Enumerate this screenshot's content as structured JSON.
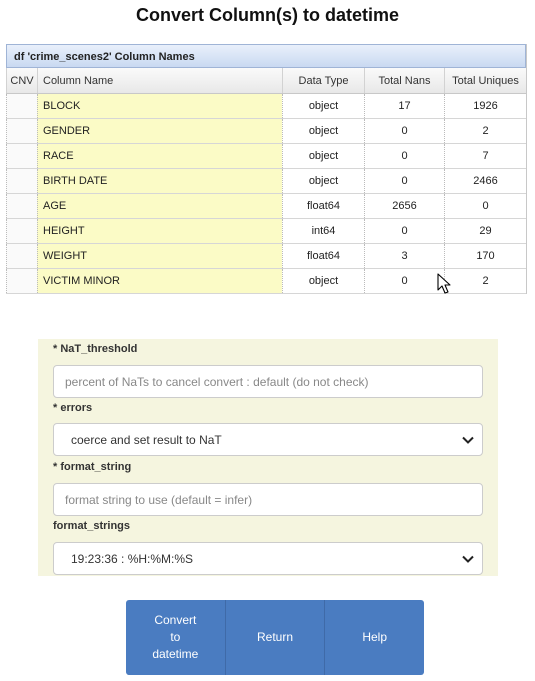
{
  "page": {
    "title": "Convert Column(s) to datetime"
  },
  "grid": {
    "caption": "df 'crime_scenes2' Column Names",
    "headers": {
      "cnv": "CNV",
      "name": "Column Name",
      "type": "Data Type",
      "nans": "Total Nans",
      "uniques": "Total Uniques"
    },
    "rows": [
      {
        "name": "BLOCK",
        "type": "object",
        "nans": "17",
        "uniques": "1926"
      },
      {
        "name": "GENDER",
        "type": "object",
        "nans": "0",
        "uniques": "2"
      },
      {
        "name": "RACE",
        "type": "object",
        "nans": "0",
        "uniques": "7"
      },
      {
        "name": "BIRTH DATE",
        "type": "object",
        "nans": "0",
        "uniques": "2466"
      },
      {
        "name": "AGE",
        "type": "float64",
        "nans": "2656",
        "uniques": "0"
      },
      {
        "name": "HEIGHT",
        "type": "int64",
        "nans": "0",
        "uniques": "29"
      },
      {
        "name": "WEIGHT",
        "type": "float64",
        "nans": "3",
        "uniques": "170"
      },
      {
        "name": "VICTIM MINOR",
        "type": "object",
        "nans": "0",
        "uniques": "2"
      }
    ]
  },
  "form": {
    "nat_threshold": {
      "label": "* NaT_threshold",
      "value": "",
      "placeholder": "percent of NaTs to cancel convert : default (do not check)"
    },
    "errors": {
      "label": "* errors",
      "selected": "coerce and set result to NaT"
    },
    "format_string": {
      "label": "* format_string",
      "value": "",
      "placeholder": "format string to use (default = infer)"
    },
    "format_strings": {
      "label": "format_strings",
      "selected": "19:23:36 : %H:%M:%S"
    }
  },
  "buttons": {
    "convert": "Convert\nto\ndatetime",
    "return": "Return",
    "help": "Help"
  },
  "colors": {
    "button_bg": "#4a7cc1",
    "name_cell_bg": "#fbfbc6",
    "form_bg": "#f5f5df"
  }
}
